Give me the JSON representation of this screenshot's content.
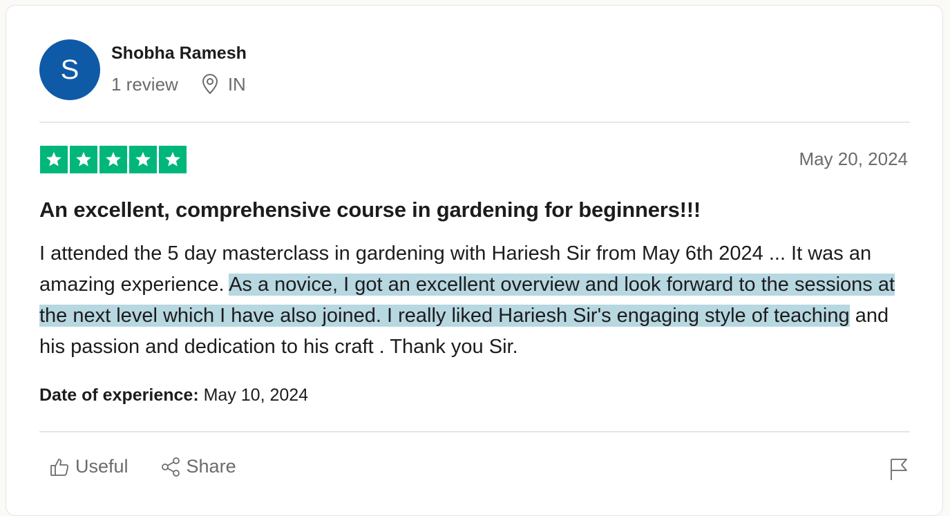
{
  "reviewer": {
    "initial": "S",
    "name": "Shobha Ramesh",
    "review_count": "1 review",
    "country": "IN",
    "avatar_color": "#0f5aa6"
  },
  "review": {
    "rating": 5,
    "rating_max": 5,
    "star_color": "#00b67a",
    "date": "May 20, 2024",
    "title": "An excellent, comprehensive course in gardening for beginners!!!",
    "body_before": "I attended the 5 day masterclass in gardening with Hariesh Sir from May 6th 2024 ... It was an amazing experience. ",
    "body_highlighted": "As a novice, I got an excellent overview and look forward to the sessions at the next level which I have also joined. I really liked Hariesh Sir's engaging style of teaching",
    "body_after": " and his passion and dedication to his craft . Thank you Sir.",
    "highlight_color": "#b7d7e1",
    "experience_label": "Date of experience:",
    "experience_date": "May 10, 2024"
  },
  "actions": {
    "useful_label": "Useful",
    "share_label": "Share",
    "useful_icon": "thumbs-up-icon",
    "share_icon": "share-icon",
    "flag_icon": "flag-icon"
  }
}
